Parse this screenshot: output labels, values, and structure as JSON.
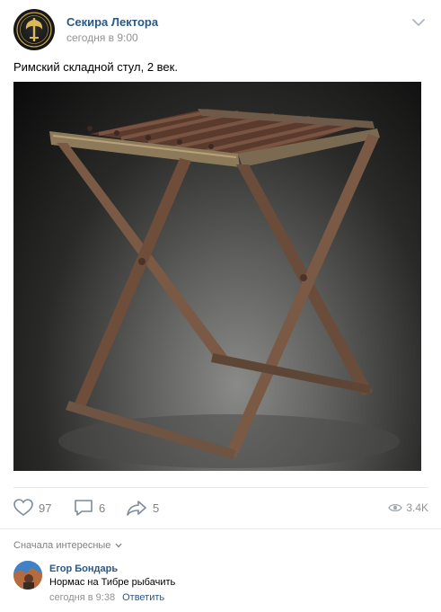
{
  "post": {
    "author": "Секира Лектора",
    "time": "сегодня в 9:00",
    "text": "Римский складной стул, 2 век.",
    "avatar_icon": "axe-emblem-icon",
    "image_alt": "roman-folding-stool-photo"
  },
  "actions": {
    "likes": "97",
    "comments": "6",
    "shares": "5",
    "views": "3.4K"
  },
  "comments_section": {
    "sort_label": "Сначала интересные",
    "items": [
      {
        "author": "Егор Бондарь",
        "text": "Нормас на Тибре рыбачить",
        "time": "сегодня в 9:38",
        "reply_label": "Ответить"
      }
    ]
  },
  "colors": {
    "link": "#2a5885",
    "muted": "#828282",
    "divider": "#e7e8ec"
  }
}
